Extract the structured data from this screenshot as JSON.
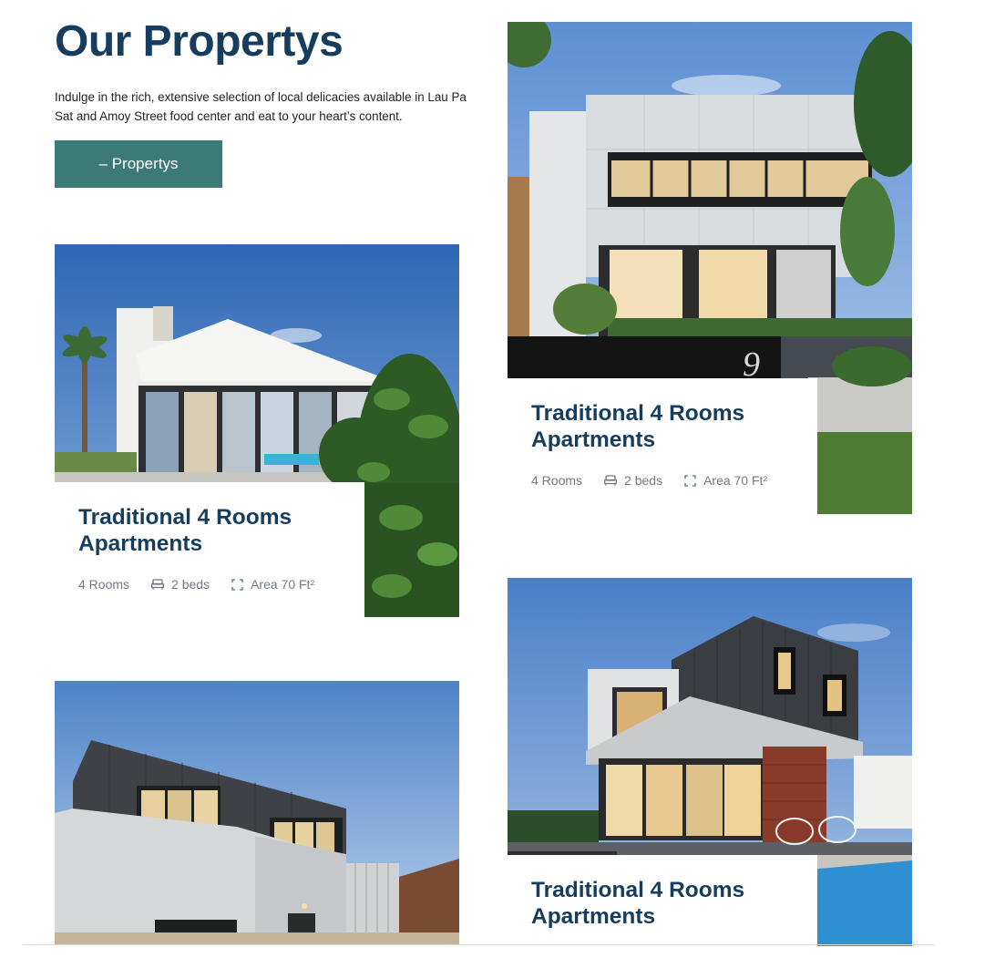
{
  "header": {
    "title": "Our Propertys",
    "intro": "Indulge in the rich, extensive selection of local delicacies available in Lau Pa Sat and Amoy Street food center and eat to your heart’s content.",
    "cta_label": "– Propertys"
  },
  "colors": {
    "primary": "#173d5e",
    "accent": "#3c7a78",
    "meta_text": "#707a84"
  },
  "properties": [
    {
      "title": "Traditional 4 Rooms Apartments",
      "rooms": "4 Rooms",
      "beds": "2 beds",
      "area": "Area 70 Ft²",
      "bed_icon": "bed-icon",
      "area_icon": "area-icon"
    },
    {
      "title": "Traditional 4 Rooms Apartments",
      "rooms": "4 Rooms",
      "beds": "2 beds",
      "area": "Area 70 Ft²",
      "bed_icon": "bed-icon",
      "area_icon": "area-icon"
    },
    {
      "title": "Traditional 4 Rooms Apartments"
    }
  ]
}
